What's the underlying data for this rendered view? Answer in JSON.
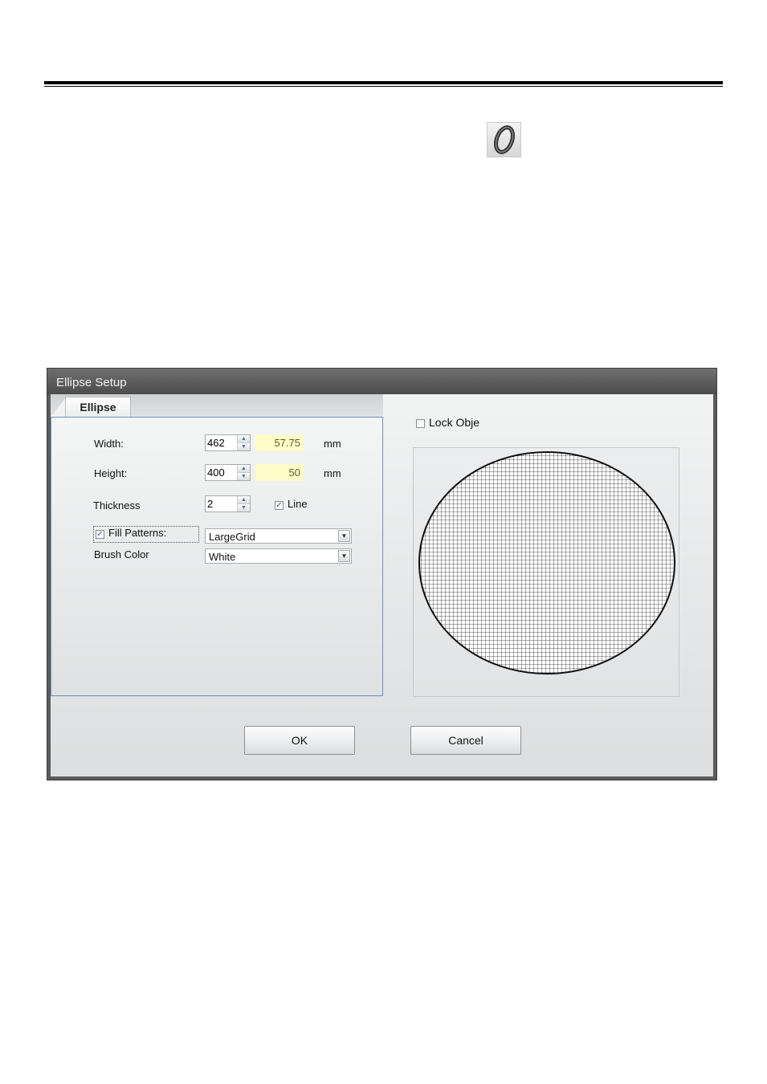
{
  "dialog": {
    "title": "Ellipse Setup",
    "tab": "Ellipse",
    "width": {
      "label": "Width:",
      "value": "462",
      "mm": "57.75",
      "unit": "mm"
    },
    "height": {
      "label": "Height:",
      "value": "400",
      "mm": "50",
      "unit": "mm"
    },
    "thickness": {
      "label": "Thickness",
      "value": "2"
    },
    "line": {
      "label": "Line",
      "checked": true
    },
    "fill_patterns": {
      "label": "Fill Patterns:",
      "checked": true,
      "value": "LargeGrid"
    },
    "brush_color": {
      "label": "Brush Color",
      "value": "White"
    },
    "lock_object": {
      "label": "Lock Obje",
      "checked": false
    },
    "ok_label": "OK",
    "cancel_label": "Cancel"
  },
  "colors": {
    "titlebar": "#5b5b5b",
    "mm_box": "#fdfbc8",
    "panel_border": "#6f8fc2"
  },
  "icons": {
    "ellipse_tool": "ellipse-tool-icon",
    "check": "check-icon",
    "spin": "spin-arrow-icon",
    "dropdown": "dropdown-arrow-icon"
  }
}
